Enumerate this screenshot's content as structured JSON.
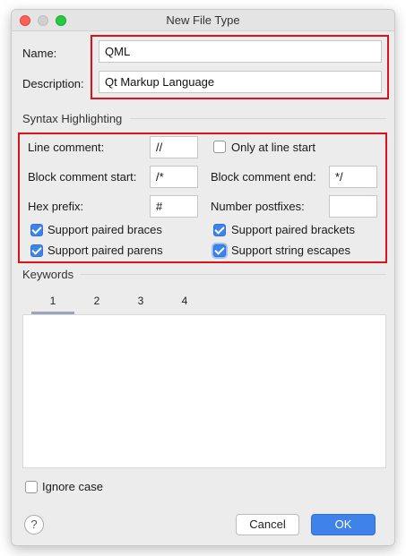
{
  "window": {
    "title": "New File Type"
  },
  "name": {
    "label": "Name:",
    "value": "QML"
  },
  "description": {
    "label": "Description:",
    "value": "Qt Markup Language"
  },
  "syntax": {
    "section_title": "Syntax Highlighting",
    "line_comment_label": "Line comment:",
    "line_comment_value": "//",
    "only_line_start_label": "Only at line start",
    "only_line_start_checked": false,
    "block_start_label": "Block comment start:",
    "block_start_value": "/*",
    "block_end_label": "Block comment end:",
    "block_end_value": "*/",
    "hex_prefix_label": "Hex prefix:",
    "hex_prefix_value": "#",
    "number_postfixes_label": "Number postfixes:",
    "number_postfixes_value": "",
    "paired_braces_label": "Support paired braces",
    "paired_braces_checked": true,
    "paired_brackets_label": "Support paired brackets",
    "paired_brackets_checked": true,
    "paired_parens_label": "Support paired parens",
    "paired_parens_checked": true,
    "string_escapes_label": "Support string escapes",
    "string_escapes_checked": true
  },
  "keywords": {
    "section_title": "Keywords",
    "tabs": [
      {
        "label": "1",
        "active": true
      },
      {
        "label": "2",
        "active": false
      },
      {
        "label": "3",
        "active": false
      },
      {
        "label": "4",
        "active": false
      }
    ]
  },
  "ignore_case": {
    "label": "Ignore case",
    "checked": false
  },
  "footer": {
    "help_label": "?",
    "cancel_label": "Cancel",
    "ok_label": "OK"
  },
  "colors": {
    "highlight_border": "#e0101a",
    "accent": "#3f83e8"
  }
}
